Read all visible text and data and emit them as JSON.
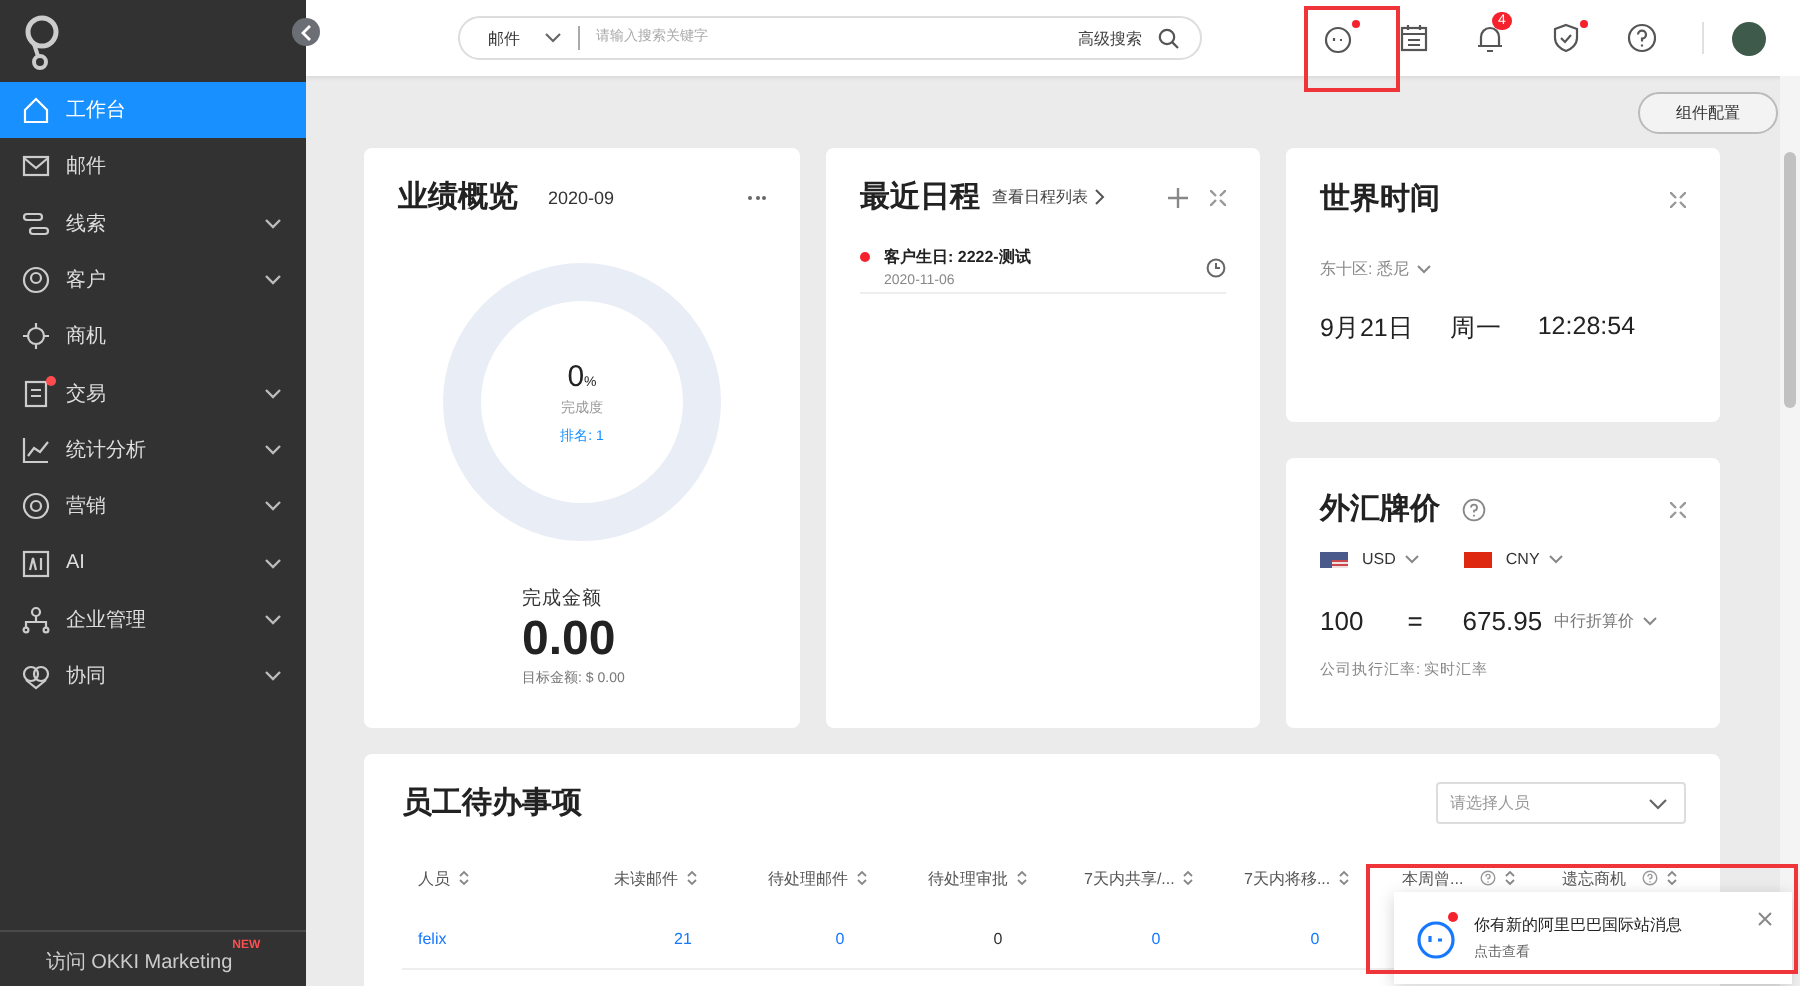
{
  "sidebar": {
    "items": [
      {
        "label": "工作台",
        "selected": true,
        "expandable": false,
        "dot": false
      },
      {
        "label": "邮件",
        "selected": false,
        "expandable": false,
        "dot": false
      },
      {
        "label": "线索",
        "selected": false,
        "expandable": true,
        "dot": false
      },
      {
        "label": "客户",
        "selected": false,
        "expandable": true,
        "dot": false
      },
      {
        "label": "商机",
        "selected": false,
        "expandable": false,
        "dot": false
      },
      {
        "label": "交易",
        "selected": false,
        "expandable": true,
        "dot": true
      },
      {
        "label": "统计分析",
        "selected": false,
        "expandable": true,
        "dot": false
      },
      {
        "label": "营销",
        "selected": false,
        "expandable": true,
        "dot": false
      },
      {
        "label": "AI",
        "selected": false,
        "expandable": true,
        "dot": false
      },
      {
        "label": "企业管理",
        "selected": false,
        "expandable": true,
        "dot": false
      },
      {
        "label": "协同",
        "selected": false,
        "expandable": true,
        "dot": false
      }
    ],
    "footer": {
      "label": "访问 OKKI Marketing",
      "badge": "NEW"
    }
  },
  "search": {
    "scope": "邮件",
    "placeholder": "请输入搜索关键字",
    "advanced": "高级搜索"
  },
  "toolbar": {
    "assistant_dot": true,
    "notification_count": "4",
    "security_dot": true
  },
  "config_button": "组件配置",
  "performance": {
    "title": "业绩概览",
    "period": "2020-09",
    "percent": "0",
    "percent_unit": "%",
    "percent_label": "完成度",
    "rank": "排名: 1",
    "level": 0,
    "amount_label": "完成金额",
    "amount": "0.00",
    "target": "目标金额: $ 0.00"
  },
  "schedule": {
    "title": "最近日程",
    "list_link": "查看日程列表",
    "events": [
      {
        "title": "客户生日: 2222-测试",
        "date": "2020-11-06"
      }
    ]
  },
  "world_time": {
    "title": "世界时间",
    "zone": "东十区: 悉尼",
    "date": "9月21日",
    "weekday": "周一",
    "time": "12:28:54"
  },
  "forex": {
    "title": "外汇牌价",
    "from": "USD",
    "to": "CNY",
    "amount": "100",
    "equals": "=",
    "result": "675.95",
    "rate_type": "中行折算价",
    "note": "公司执行汇率: 实时汇率"
  },
  "todo": {
    "title": "员工待办事项",
    "select_placeholder": "请选择人员",
    "columns": [
      {
        "label": "人员",
        "help": false
      },
      {
        "label": "未读邮件",
        "help": false
      },
      {
        "label": "待处理邮件",
        "help": false
      },
      {
        "label": "待处理审批",
        "help": false
      },
      {
        "label": "7天内共享/...",
        "help": false
      },
      {
        "label": "7天内将移...",
        "help": false
      },
      {
        "label": "本周曾...",
        "help": true
      },
      {
        "label": "遗忘商机",
        "help": true
      }
    ],
    "rows": [
      [
        "felix",
        "21",
        "0",
        "0",
        "0",
        "0"
      ]
    ]
  },
  "toast": {
    "title": "你有新的阿里巴巴国际站消息",
    "link": "点击查看",
    "dot": true
  }
}
